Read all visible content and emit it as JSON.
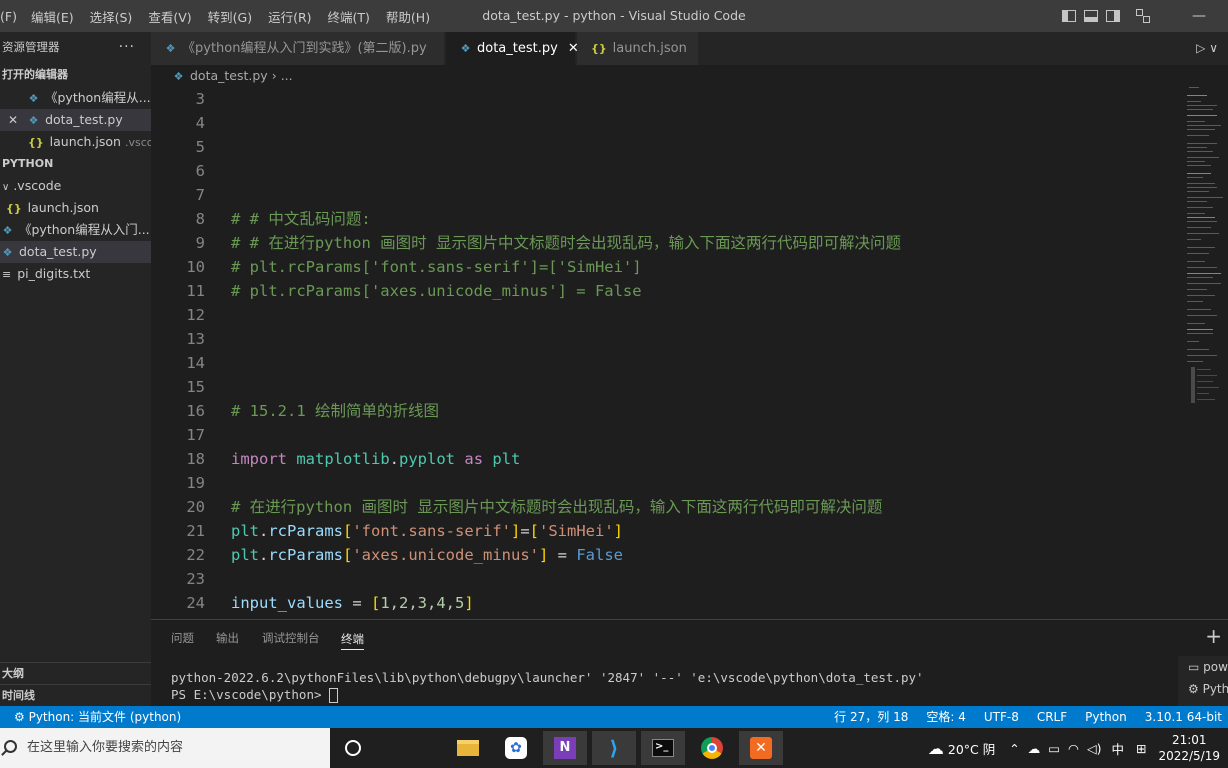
{
  "titlebar": {
    "menu": [
      "(F)",
      "编辑(E)",
      "选择(S)",
      "查看(V)",
      "转到(G)",
      "运行(R)",
      "终端(T)",
      "帮助(H)"
    ],
    "title": "dota_test.py - python - Visual Studio Code"
  },
  "sidebar": {
    "header": "资源管理器",
    "more": "···",
    "open_editors_title": "打开的编辑器",
    "open_editors": [
      {
        "name": "《python编程从...",
        "icon": "python-file-icon"
      },
      {
        "name": "dota_test.py",
        "icon": "python-file-icon",
        "close": "✕"
      },
      {
        "name": "launch.json",
        "icon": "json-file-icon",
        "desc": ".vsco..."
      }
    ],
    "folder_title": "PYTHON",
    "tree": [
      {
        "name": ".vscode",
        "icon": "chevron-down-icon"
      },
      {
        "name": "launch.json",
        "icon": "json-file-icon"
      },
      {
        "name": "《python编程从入门...",
        "icon": "python-file-icon"
      },
      {
        "name": "dota_test.py",
        "icon": "python-file-icon"
      },
      {
        "name": "pi_digits.txt",
        "icon": "text-file-icon"
      }
    ],
    "outline": "大纲",
    "timeline": "时间线"
  },
  "tabs": [
    {
      "label": "《python编程从入门到实践》(第二版).py",
      "icon": "python-file-icon"
    },
    {
      "label": "dota_test.py",
      "icon": "python-file-icon",
      "close": "✕"
    },
    {
      "label": "launch.json",
      "icon": "json-file-icon"
    }
  ],
  "breadcrumb": {
    "file": "dota_test.py",
    "sep": "›",
    "rest": "..."
  },
  "editor": {
    "line_numbers": [
      "3",
      "4",
      "5",
      "6",
      "7",
      "8",
      "9",
      "10",
      "11",
      "12",
      "13",
      "14",
      "15",
      "16",
      "17",
      "18",
      "19",
      "20",
      "21",
      "22",
      "23",
      "24"
    ],
    "lines": {
      "l8": "# # 中文乱码问题:",
      "l9": "# # 在进行python 画图时 显示图片中文标题时会出现乱码，输入下面这两行代码即可解决问题",
      "l10": "# plt.rcParams['font.sans-serif']=['SimHei']",
      "l11": "# plt.rcParams['axes.unicode_minus'] = False",
      "l16": "# 15.2.1 绘制简单的折线图",
      "l18_import": "import",
      "l18_module": "matplotlib",
      "l18_dot": ".",
      "l18_sub": "pyplot",
      "l18_as": "as",
      "l18_alias": "plt",
      "l20": "# 在进行python 画图时 显示图片中文标题时会出现乱码，输入下面这两行代码即可解决问题",
      "l21_obj": "plt",
      "l21_dot": ".",
      "l21_attr": "rcParams",
      "l21_lb": "[",
      "l21_key": "'font.sans-serif'",
      "l21_rb": "]",
      "l21_eq": "=",
      "l21_vlb": "[",
      "l21_val": "'SimHei'",
      "l21_vrb": "]",
      "l22_obj": "plt",
      "l22_dot": ".",
      "l22_attr": "rcParams",
      "l22_lb": "[",
      "l22_key": "'axes.unicode_minus'",
      "l22_rb": "]",
      "l22_eq": " = ",
      "l22_val": "False",
      "l24_var": "input_values",
      "l24_eq": " = ",
      "l24_lb": "[",
      "l24_nums": "1,2,3,4,5",
      "l24_rb": "]"
    }
  },
  "panel": {
    "tabs": [
      "问题",
      "输出",
      "调试控制台",
      "终端"
    ],
    "active_tab": "终端",
    "terminal_lines": [
      "python-2022.6.2\\pythonFiles\\lib\\python\\debugpy\\launcher' '2847' '--' 'e:\\vscode\\python\\dota_test.py'",
      "PS E:\\vscode\\python> "
    ],
    "add": "+",
    "term_list": [
      "pow",
      "Pyth"
    ]
  },
  "statusbar": {
    "left": "Python: 当前文件 (python)",
    "right": [
      "行 27，列 18",
      "空格: 4",
      "UTF-8",
      "CRLF",
      "Python",
      "3.10.1 64-bit"
    ]
  },
  "taskbar": {
    "search_placeholder": "在这里输入你要搜索的内容",
    "weather": "20°C 阴",
    "ime": "中",
    "time": "21:01",
    "date": "2022/5/19"
  },
  "colors": {
    "statusbar": "#007acc",
    "comment": "#6a9955",
    "keyword": "#c586c0",
    "string": "#ce9178",
    "number": "#b5cea8"
  }
}
